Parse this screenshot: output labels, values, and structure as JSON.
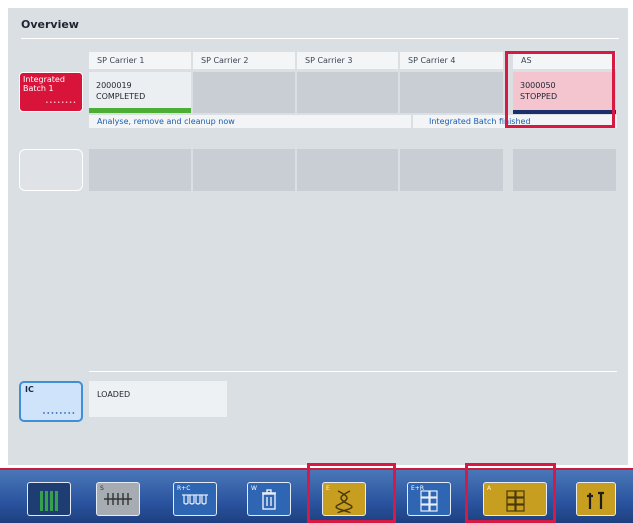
{
  "panel": {
    "title": "Overview"
  },
  "columns": [
    "SP Carrier 1",
    "SP Carrier 2",
    "SP Carrier 3",
    "SP Carrier 4",
    "AS"
  ],
  "batch": {
    "button_label": "Integrated Batch 1",
    "dots": "••••••••",
    "carrier1_id": "2000019",
    "carrier1_status": "COMPLETED",
    "as_id": "3000050",
    "as_status": "STOPPED",
    "status_left": "Analyse, remove and cleanup now",
    "status_right": "Integrated Batch finished",
    "progress_color": "#4cae34",
    "stopped_color": "#f4c4cf"
  },
  "ic": {
    "button_label": "IC",
    "dots": "••••••••",
    "status": "LOADED"
  },
  "toolbar": {
    "buttons": [
      {
        "label": "",
        "icon": "tube-rack-icon"
      },
      {
        "label": "S",
        "icon": "sample-rack-icon"
      },
      {
        "label": "R+C",
        "icon": "reagent-cartridge-icon"
      },
      {
        "label": "W",
        "icon": "waste-bin-icon"
      },
      {
        "label": "E",
        "icon": "dna-icon"
      },
      {
        "label": "E+R",
        "icon": "eluate-reagent-icon"
      },
      {
        "label": "A",
        "icon": "assay-grid-icon"
      },
      {
        "label": "",
        "icon": "tools-icon"
      }
    ]
  },
  "colors": {
    "accent_red": "#d71a43",
    "gold": "#c89e21",
    "blue": "#2f66b3"
  }
}
